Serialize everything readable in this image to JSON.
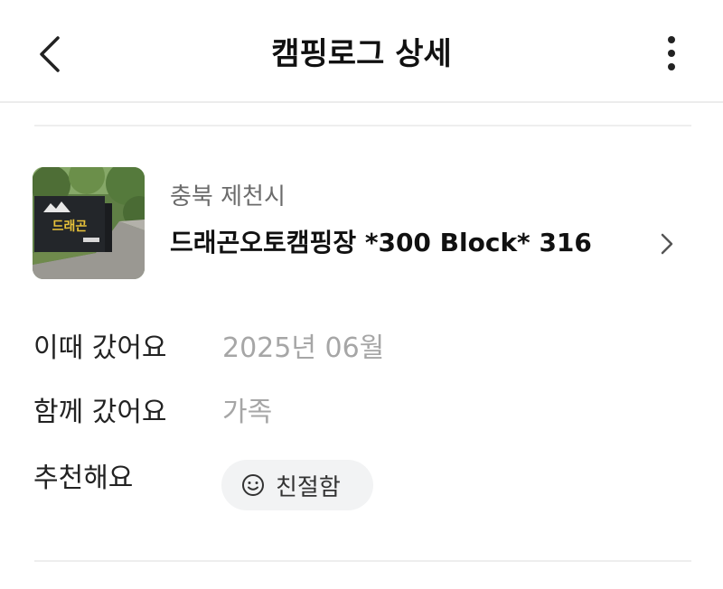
{
  "header": {
    "title": "캠핑로그 상세",
    "back_icon": "chevron-left-icon",
    "more_icon": "more-vertical-icon"
  },
  "campsite": {
    "region": "충북 제천시",
    "name": "드래곤오토캠핑장 *300 Block* 316",
    "thumbnail_sign_text": "드래곤",
    "chevron_icon": "chevron-right-icon"
  },
  "details": {
    "visited_label": "이때 갔어요",
    "visited_value": "2025년 06월",
    "companion_label": "함께 갔어요",
    "companion_value": "가족",
    "recommend_label": "추천해요",
    "recommend_chip": {
      "icon": "smile-icon",
      "label": "친절함"
    }
  },
  "colors": {
    "primary_text": "#111111",
    "secondary_text": "#6b6b6b",
    "muted_value": "#a6a6a6",
    "chip_bg": "#f2f3f4",
    "divider": "#eeeeee"
  }
}
